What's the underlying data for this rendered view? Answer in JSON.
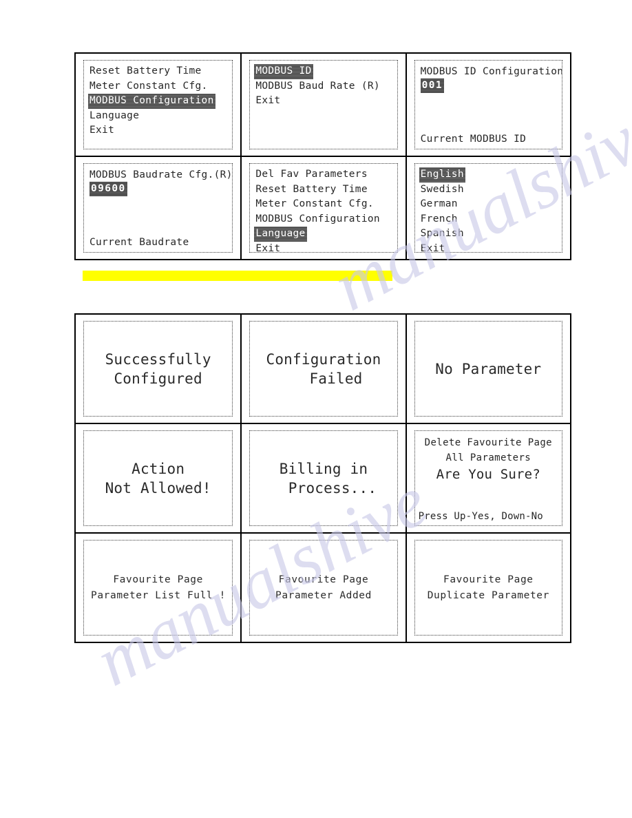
{
  "watermark": {
    "line1": "manualshive.com",
    "line2": "manualshive"
  },
  "highlight_bar": {
    "color": "#ffff00",
    "text": ""
  },
  "menu_table": {
    "panels": [
      {
        "kind": "menu",
        "name": "main-menu-modbus-configuration",
        "items": [
          {
            "label": "Reset Battery Time",
            "selected": false
          },
          {
            "label": "Meter Constant Cfg.",
            "selected": false
          },
          {
            "label": "MODBUS Configuration",
            "selected": true
          },
          {
            "label": "Language",
            "selected": false
          },
          {
            "label": "Exit",
            "selected": false
          }
        ]
      },
      {
        "kind": "menu",
        "name": "modbus-submenu",
        "items": [
          {
            "label": "MODBUS ID",
            "selected": true
          },
          {
            "label": "MODBUS Baud Rate (R)",
            "selected": false
          },
          {
            "label": "Exit",
            "selected": false
          }
        ]
      },
      {
        "kind": "value",
        "name": "modbus-id-configuration",
        "title": "MODBUS ID Configuration",
        "value": "001",
        "footer": "Current MODBUS ID"
      },
      {
        "kind": "value",
        "name": "modbus-baudrate-configuration",
        "title": "MODBUS Baudrate Cfg.(R)",
        "value": "09600",
        "footer": "Current Baudrate"
      },
      {
        "kind": "menu",
        "name": "main-menu-language",
        "items": [
          {
            "label": "Del Fav Parameters",
            "selected": false
          },
          {
            "label": "Reset Battery Time",
            "selected": false
          },
          {
            "label": "Meter Constant Cfg.",
            "selected": false
          },
          {
            "label": "MODBUS Configuration",
            "selected": false
          },
          {
            "label": "Language",
            "selected": true
          },
          {
            "label": "Exit",
            "selected": false
          }
        ]
      },
      {
        "kind": "menu",
        "name": "language-menu",
        "items": [
          {
            "label": "English",
            "selected": true
          },
          {
            "label": "Swedish",
            "selected": false
          },
          {
            "label": "German",
            "selected": false
          },
          {
            "label": "French",
            "selected": false
          },
          {
            "label": "Spanish",
            "selected": false
          },
          {
            "label": "Exit",
            "selected": false
          }
        ]
      }
    ]
  },
  "message_table": {
    "panels": [
      {
        "kind": "message",
        "name": "message-successfully-configured",
        "size": "big",
        "lines": [
          "Successfully",
          "Configured"
        ],
        "indent": [
          0,
          0
        ]
      },
      {
        "kind": "message",
        "name": "message-configuration-failed",
        "size": "big",
        "lines": [
          "Configuration",
          "Failed"
        ],
        "indent": [
          0,
          1
        ]
      },
      {
        "kind": "message",
        "name": "message-no-parameter",
        "size": "big",
        "lines": [
          "No Parameter"
        ],
        "indent": [
          0
        ]
      },
      {
        "kind": "message",
        "name": "message-action-not-allowed",
        "size": "big",
        "lines": [
          "Action",
          "Not Allowed!"
        ],
        "indent": [
          0,
          0
        ]
      },
      {
        "kind": "message",
        "name": "message-billing-in-process",
        "size": "big",
        "lines": [
          "Billing in",
          "Process..."
        ],
        "indent": [
          0,
          2
        ]
      },
      {
        "kind": "confirm",
        "name": "message-delete-favourite-confirm",
        "lines": [
          "Delete Favourite Page",
          "All Parameters"
        ],
        "emphasis": "Are You Sure?",
        "footer": "Press Up-Yes, Down-No"
      },
      {
        "kind": "message",
        "name": "message-favourite-list-full",
        "size": "med",
        "lines": [
          "Favourite Page",
          "Parameter List Full !"
        ],
        "indent": [
          0,
          0
        ]
      },
      {
        "kind": "message",
        "name": "message-favourite-parameter-added",
        "size": "med",
        "lines": [
          "Favourite Page",
          "Parameter Added"
        ],
        "indent": [
          0,
          0
        ]
      },
      {
        "kind": "message",
        "name": "message-favourite-duplicate-parameter",
        "size": "med",
        "lines": [
          "Favourite Page",
          "Duplicate Parameter"
        ],
        "indent": [
          0,
          0
        ]
      }
    ]
  }
}
